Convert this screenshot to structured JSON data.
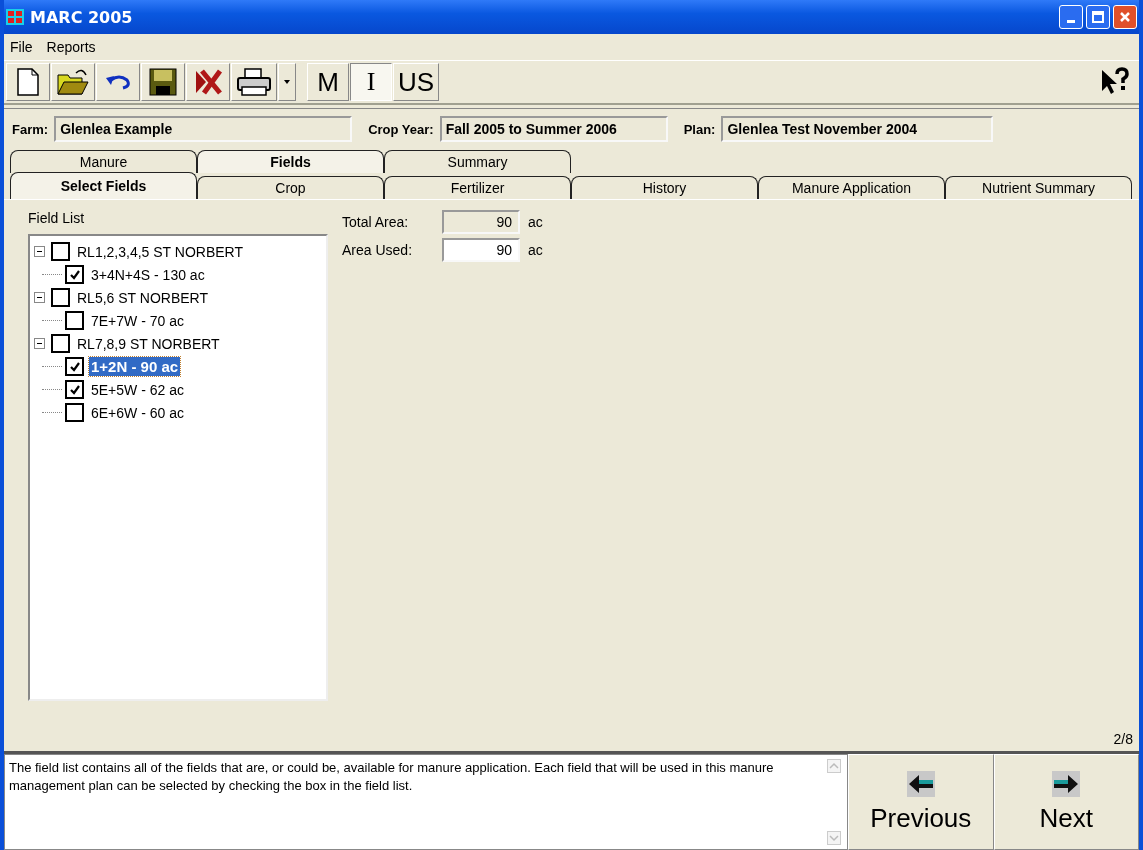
{
  "window": {
    "title": "MARC 2005"
  },
  "menu": [
    {
      "label": "File"
    },
    {
      "label": "Reports"
    }
  ],
  "toolbar": [
    {
      "kind": "new"
    },
    {
      "kind": "open"
    },
    {
      "kind": "undo"
    },
    {
      "kind": "save"
    },
    {
      "kind": "delete"
    },
    {
      "kind": "print"
    },
    {
      "kind": "dropdown"
    }
  ],
  "units": [
    {
      "label": "M",
      "selected": false
    },
    {
      "label": "I",
      "selected": true
    },
    {
      "label": "US",
      "selected": false
    }
  ],
  "header": [
    {
      "label": "Farm:",
      "value": "Glenlea Example"
    },
    {
      "label": "Crop Year:",
      "value": "Fall 2005 to Summer 2006"
    },
    {
      "label": "Plan:",
      "value": "Glenlea Test November 2004"
    }
  ],
  "main_tabs": [
    {
      "label": "Manure",
      "selected": false
    },
    {
      "label": "Fields",
      "selected": true
    },
    {
      "label": "Summary",
      "selected": false
    }
  ],
  "sub_tabs": [
    {
      "label": "Select Fields",
      "selected": true
    },
    {
      "label": "Crop",
      "selected": false
    },
    {
      "label": "Fertilizer",
      "selected": false
    },
    {
      "label": "History",
      "selected": false
    },
    {
      "label": "Manure Application",
      "selected": false
    },
    {
      "label": "Nutrient Summary",
      "selected": false
    }
  ],
  "field_list": {
    "label": "Field List",
    "items": [
      {
        "label": "RL1,2,3,4,5 ST NORBERT",
        "checked": false,
        "expanded": true,
        "selected": false,
        "children": [
          {
            "label": "3+4N+4S - 130 ac",
            "checked": true,
            "selected": false
          }
        ]
      },
      {
        "label": "RL5,6 ST NORBERT",
        "checked": false,
        "expanded": true,
        "selected": false,
        "children": [
          {
            "label": "7E+7W - 70 ac",
            "checked": false,
            "selected": false
          }
        ]
      },
      {
        "label": "RL7,8,9 ST NORBERT",
        "checked": false,
        "expanded": true,
        "selected": false,
        "children": [
          {
            "label": "1+2N - 90 ac",
            "checked": true,
            "selected": true
          },
          {
            "label": "5E+5W - 62 ac",
            "checked": true,
            "selected": false
          },
          {
            "label": "6E+6W - 60 ac",
            "checked": false,
            "selected": false
          }
        ]
      }
    ]
  },
  "area": [
    {
      "label": "Total Area:",
      "value": "90",
      "unit": "ac",
      "disabled": true
    },
    {
      "label": "Area Used:",
      "value": "90",
      "unit": "ac",
      "disabled": false
    }
  ],
  "page": "2/8",
  "description": "The field list contains all of the fields that are, or could be, available for manure application.  Each field that will be used in this manure management plan can be selected by checking the box in the field list.",
  "nav": [
    {
      "kind": "previous",
      "label": "Previous"
    },
    {
      "kind": "next",
      "label": "Next"
    }
  ]
}
